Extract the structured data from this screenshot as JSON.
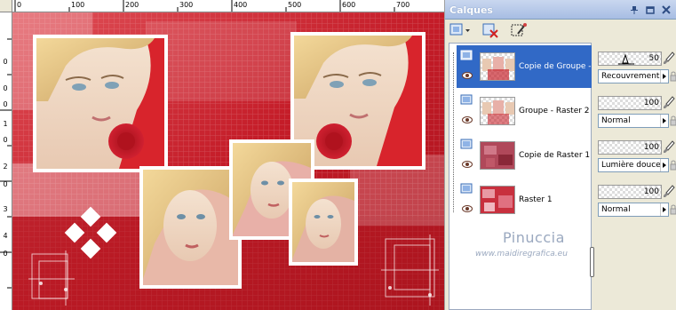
{
  "rulers": {
    "top_labels": [
      "0",
      "100",
      "200",
      "300",
      "400",
      "500",
      "600",
      "700"
    ],
    "left_labels": [
      "0",
      "0",
      "0",
      "1",
      "0",
      "2",
      "0",
      "3",
      "4",
      "0"
    ]
  },
  "panel": {
    "title": "Calques",
    "title_buttons": [
      "pin-icon",
      "restore-icon",
      "close-icon"
    ]
  },
  "toolbar": {
    "buttons": [
      "new-layer-icon",
      "delete-layer-icon",
      "mask-icon"
    ]
  },
  "layers": [
    {
      "name": "Copie de Groupe -",
      "selected": true,
      "opacity": "50",
      "blend": "Recouvrement"
    },
    {
      "name": "Groupe - Raster 2",
      "selected": false,
      "opacity": "100",
      "blend": "Normal"
    },
    {
      "name": "Copie de Raster 1",
      "selected": false,
      "opacity": "100",
      "blend": "Lumière douce"
    },
    {
      "name": "Raster 1",
      "selected": false,
      "opacity": "100",
      "blend": "Normal"
    }
  ],
  "watermark": {
    "title": "Pinuccia",
    "url": "www.maidiregrafica.eu"
  },
  "colors": {
    "accent": "#3169c6",
    "canvas_red": "#c8262f",
    "panel_bg": "#ece9d8",
    "watermark": "#9aa8bf"
  }
}
